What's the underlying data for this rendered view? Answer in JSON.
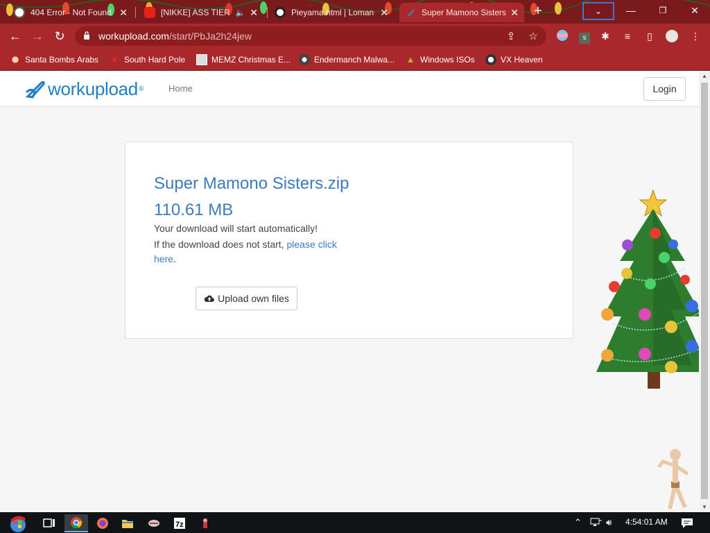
{
  "browser": {
    "tabs": [
      {
        "title": "404 Error - Not Found",
        "icon": "globe-icon",
        "active": false
      },
      {
        "title": "[NIKKE] ASS TIER",
        "icon": "youtube-icon",
        "active": false,
        "audio": true
      },
      {
        "title": "Pieyama.html | Loman",
        "icon": "panda-icon",
        "active": false
      },
      {
        "title": "Super Mamono Sisters",
        "icon": "workupload-icon",
        "active": true
      }
    ],
    "close_glyph": "✕",
    "new_tab_glyph": "+",
    "window_controls": {
      "minimize": "—",
      "restore": "❐",
      "close": "✕"
    },
    "url_host": "workupload.com",
    "url_path": "/start/PbJa2h24jew",
    "bookmarks": [
      {
        "label": "Santa Bombs Arabs",
        "icon": "santa-icon"
      },
      {
        "label": "South Hard Pole",
        "icon": "snowflake-icon"
      },
      {
        "label": "MEMZ Christmas E...",
        "icon": "memz-icon"
      },
      {
        "label": "Endermanch Malwa...",
        "icon": "raccoon-icon"
      },
      {
        "label": "Windows ISOs",
        "icon": "tree-icon"
      },
      {
        "label": "VX Heaven",
        "icon": "vx-icon"
      }
    ]
  },
  "site": {
    "brand": "workupload",
    "brand_mark": "®",
    "nav_home": "Home",
    "login_label": "Login"
  },
  "download": {
    "title": "Super Mamono Sisters.zip 110.61 MB",
    "auto_message": "Your download will start automatically!",
    "fallback_prefix": "If the download does not start, ",
    "fallback_link": "please click here",
    "fallback_suffix": ".",
    "upload_label": "Upload own files"
  },
  "taskbar": {
    "apps": [
      "start-icon",
      "task-view-icon",
      "chrome-icon",
      "firefox-icon",
      "file-explorer-icon",
      "network-app-icon",
      "7zip-icon",
      "game-icon"
    ],
    "clock": "4:54:01 AM"
  },
  "colors": {
    "chrome_frame": "#a9282b",
    "chrome_tabstrip": "#7a1a1c",
    "brand_blue": "#1e7ec8",
    "link_blue": "#3b7cc0"
  }
}
